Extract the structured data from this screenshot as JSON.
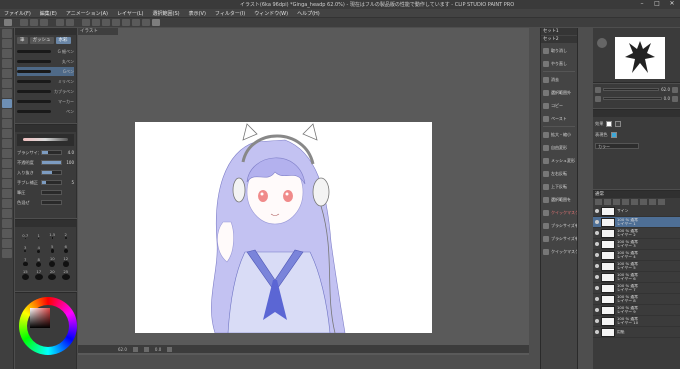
{
  "title_bar": {
    "title": "イラスト(6ka 96dpi) *Ginga_headp 62.0%) - 現在はフルの製品版の性能で動作しています - CLIP STUDIO PAINT PRO",
    "buttons": [
      "–",
      "□",
      "✕"
    ]
  },
  "menu": [
    "ファイル(F)",
    "編集(E)",
    "アニメーション(A)",
    "レイヤー(L)",
    "選択範囲(S)",
    "表示(V)",
    "フィルター(I)",
    "ウィンドウ(W)",
    "ヘルプ(H)"
  ],
  "subtool_panel": {
    "tabs": [
      "筆",
      "ガッシュ",
      "水彩"
    ],
    "brushes": [
      {
        "label": "G 細ペン"
      },
      {
        "label": "丸ペン"
      },
      {
        "label": "Gペン"
      },
      {
        "label": "ミリペン"
      },
      {
        "label": "カブラペン"
      },
      {
        "label": "マーカー"
      },
      {
        "label": "ペン"
      }
    ]
  },
  "tool_property": {
    "rows": [
      {
        "label": "ブラシサイズ",
        "value": "4.0",
        "fill": 0.3
      },
      {
        "label": "不透明度",
        "value": "100",
        "fill": 1.0
      },
      {
        "label": "入り抜き",
        "value": "",
        "fill": 0.55
      },
      {
        "label": "手ブレ補正",
        "value": "5",
        "fill": 0.2
      },
      {
        "label": "筆圧",
        "value": "",
        "fill": 0.0
      },
      {
        "label": "色混ぜ",
        "value": "",
        "fill": 0.0
      }
    ]
  },
  "brush_sizes": [
    {
      "num": "0.7",
      "d": 1
    },
    {
      "num": "1",
      "d": 1
    },
    {
      "num": "1.5",
      "d": 1.5
    },
    {
      "num": "2",
      "d": 2
    },
    {
      "num": "3",
      "d": 2
    },
    {
      "num": "4",
      "d": 3
    },
    {
      "num": "5",
      "d": 3.5
    },
    {
      "num": "6",
      "d": 4
    },
    {
      "num": "7",
      "d": 4.5
    },
    {
      "num": "8",
      "d": 5
    },
    {
      "num": "10",
      "d": 6
    },
    {
      "num": "12",
      "d": 6.5
    },
    {
      "num": "15",
      "d": 7
    },
    {
      "num": "17",
      "d": 7.5
    },
    {
      "num": "20",
      "d": 8
    },
    {
      "num": "25",
      "d": 8.5
    }
  ],
  "canvas": {
    "tab": "イラスト"
  },
  "status": {
    "zoom": "62.0",
    "angle": "0.0"
  },
  "right_commands": {
    "header_a": "セット1",
    "header_b": "セット2",
    "items": [
      {
        "label": "取り消し",
        "red": false
      },
      {
        "label": "やり直し",
        "red": false
      },
      {
        "label": "消去",
        "red": false
      },
      {
        "label": "選択範囲外",
        "red": false
      },
      {
        "label": "コピー",
        "red": false
      },
      {
        "label": "ペースト",
        "red": false
      },
      {
        "label": "拡大・縮小",
        "red": false
      },
      {
        "label": "自由変形",
        "red": false
      },
      {
        "label": "メッシュ変形",
        "red": false
      },
      {
        "label": "左右反転",
        "red": false
      },
      {
        "label": "上下反転",
        "red": false
      },
      {
        "label": "選択範囲を",
        "red": false
      },
      {
        "label": "クイックマスク",
        "red": true
      },
      {
        "label": "ブラシサイズを",
        "red": false
      },
      {
        "label": "ブラシサイズを",
        "red": false
      },
      {
        "label": "クイックマスク",
        "red": false
      }
    ]
  },
  "nav": {
    "zoom_value": "62.0",
    "angle_value": "0.0"
  },
  "layer_property": {
    "effect_label": "効果",
    "expression_label": "表現色",
    "expression_value": "カラー"
  },
  "layer_panel": {
    "header": "通常",
    "layers": [
      {
        "name": "サイン",
        "sub": "",
        "selected": false
      },
      {
        "name": "100 % 通常",
        "sub": "レイヤー 1",
        "selected": true
      },
      {
        "name": "100 % 通常",
        "sub": "レイヤー 2",
        "selected": false
      },
      {
        "name": "100 % 通常",
        "sub": "レイヤー 3",
        "selected": false
      },
      {
        "name": "100 % 通常",
        "sub": "レイヤー 4",
        "selected": false
      },
      {
        "name": "100 % 通常",
        "sub": "レイヤー 5",
        "selected": false
      },
      {
        "name": "100 % 通常",
        "sub": "レイヤー 6",
        "selected": false
      },
      {
        "name": "100 % 通常",
        "sub": "レイヤー 7",
        "selected": false
      },
      {
        "name": "100 % 通常",
        "sub": "レイヤー 8",
        "selected": false
      },
      {
        "name": "100 % 通常",
        "sub": "レイヤー 9",
        "selected": false
      },
      {
        "name": "100 % 通常",
        "sub": "レイヤー 10",
        "selected": false
      },
      {
        "name": "用紙",
        "sub": "",
        "selected": false
      }
    ]
  },
  "colors": {
    "accent": "#6a86a6",
    "panel": "#3b3b3b",
    "hair": "#b9b8f0",
    "uniform": "#8a8fe0"
  }
}
